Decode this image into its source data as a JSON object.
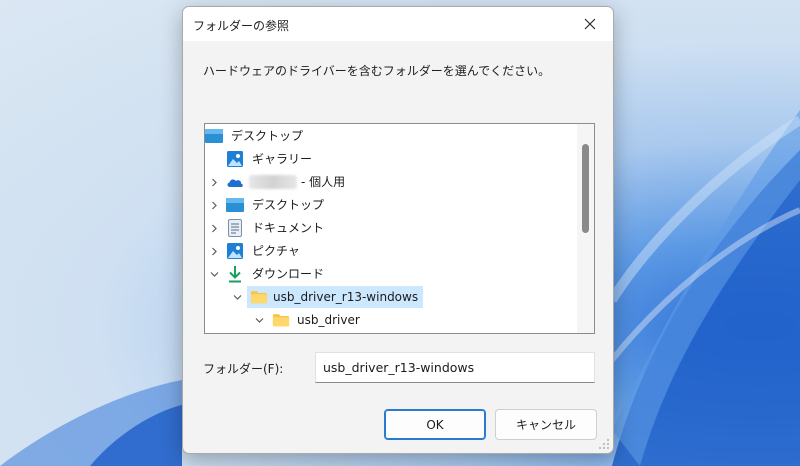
{
  "dialog": {
    "title": "フォルダーの参照",
    "instruction": "ハードウェアのドライバーを含むフォルダーを選んでください。"
  },
  "tree": {
    "items": [
      {
        "label": "デスクトップ",
        "icon": "desktop-folder-icon",
        "level": 0,
        "expander": "none"
      },
      {
        "label": "ギャラリー",
        "icon": "gallery-icon",
        "level": 1,
        "expander": "none"
      },
      {
        "label": "- 個人用",
        "icon": "onedrive-cloud-icon",
        "level": 1,
        "expander": "collapsed",
        "redacted_name": true
      },
      {
        "label": "デスクトップ",
        "icon": "desktop-folder-icon",
        "level": 1,
        "expander": "collapsed"
      },
      {
        "label": "ドキュメント",
        "icon": "documents-icon",
        "level": 1,
        "expander": "collapsed"
      },
      {
        "label": "ピクチャ",
        "icon": "pictures-icon",
        "level": 1,
        "expander": "collapsed"
      },
      {
        "label": "ダウンロード",
        "icon": "download-arrow-icon",
        "level": 1,
        "expander": "expanded"
      },
      {
        "label": "usb_driver_r13-windows",
        "icon": "folder-icon",
        "level": 2,
        "expander": "expanded",
        "selected": true
      },
      {
        "label": "usb_driver",
        "icon": "folder-icon",
        "level": 3,
        "expander": "expanded"
      }
    ]
  },
  "folder_field": {
    "label": "フォルダー(F):",
    "value": "usb_driver_r13-windows"
  },
  "buttons": {
    "ok": "OK",
    "cancel": "キャンセル"
  },
  "colors": {
    "selection": "#cce8ff",
    "accent": "#2a7ad0",
    "folder": "#f7c547",
    "download": "#1a9e5c"
  }
}
